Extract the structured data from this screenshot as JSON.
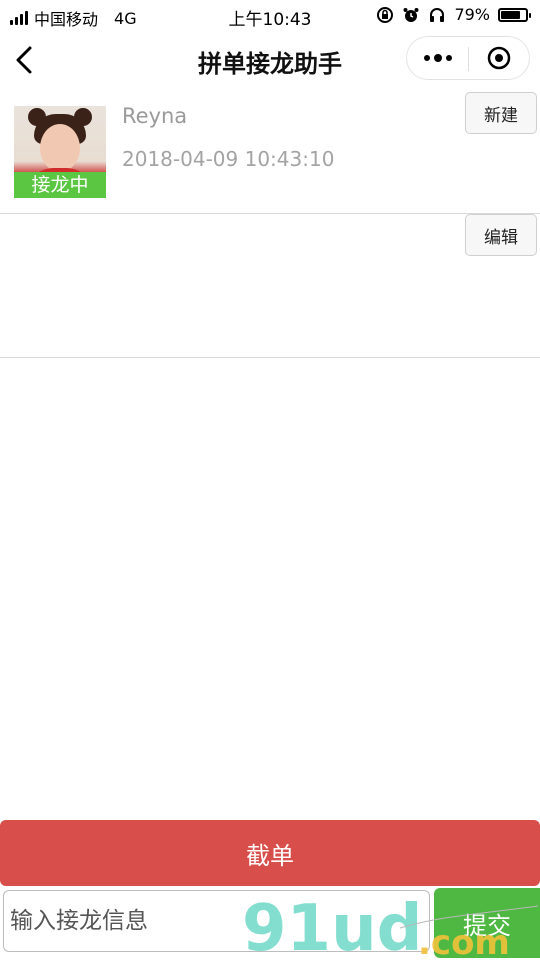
{
  "status_bar": {
    "carrier": "中国移动",
    "network": "4G",
    "time": "上午10:43",
    "battery": "79%",
    "battery_level": 0.79
  },
  "nav": {
    "title": "拼单接龙助手"
  },
  "post": {
    "status_tag": "接龙中",
    "username": "Reyna",
    "timestamp": "2018-04-09 10:43:10",
    "new_label": "新建",
    "edit_label": "编辑"
  },
  "actions": {
    "close_order_label": "截单",
    "input_placeholder": "输入接龙信息",
    "submit_label": "提交"
  },
  "watermark": {
    "text": "91ud.com"
  },
  "colors": {
    "accent_green": "#5ac641",
    "close_red": "#d84e4a",
    "submit_green": "#4fb843"
  }
}
